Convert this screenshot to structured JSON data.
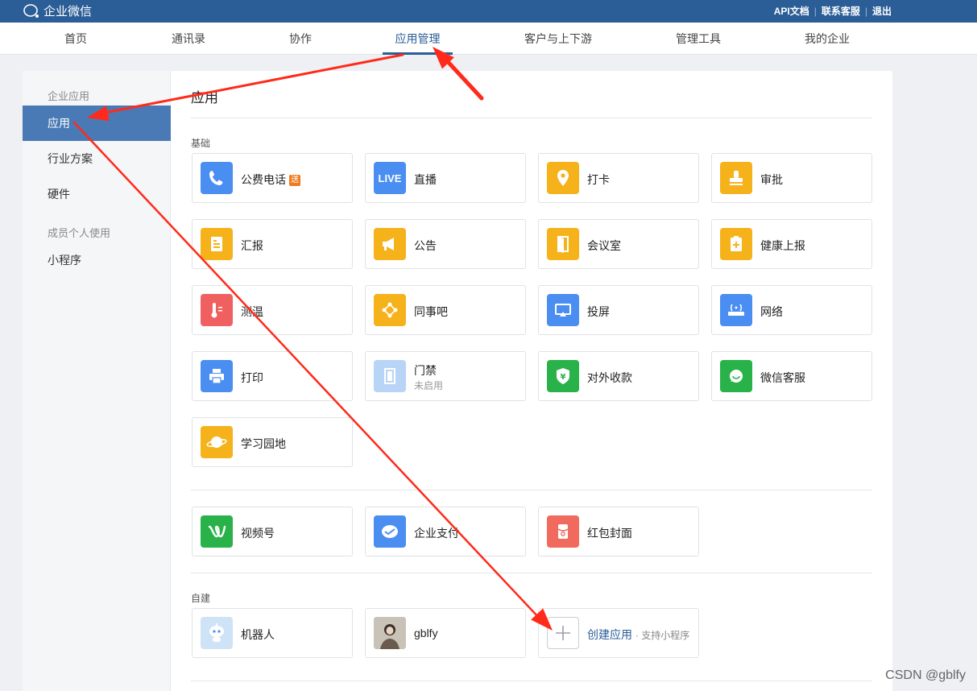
{
  "topbar": {
    "brand": "企业微信",
    "links": [
      "API文档",
      "联系客服",
      "退出"
    ]
  },
  "nav": {
    "tabs": [
      "首页",
      "通讯录",
      "协作",
      "应用管理",
      "客户与上下游",
      "管理工具",
      "我的企业"
    ],
    "active": "应用管理"
  },
  "sidebar": {
    "group1": "企业应用",
    "items": [
      "应用",
      "行业方案",
      "硬件"
    ],
    "group2": "成员个人使用",
    "items2": [
      "小程序"
    ],
    "active": "应用"
  },
  "main": {
    "title": "应用",
    "basic_label": "基础",
    "custom_label": "自建",
    "basic_apps": [
      {
        "name": "公费电话",
        "badge": "送",
        "icon": "phone-icon",
        "color": "#4a8ef2"
      },
      {
        "name": "直播",
        "icon": "live-icon",
        "icon_text": "LIVE",
        "color": "#4a8ef2"
      },
      {
        "name": "打卡",
        "icon": "location-pin-icon",
        "color": "#f5b21b"
      },
      {
        "name": "审批",
        "icon": "stamp-icon",
        "color": "#f5b21b"
      },
      {
        "name": "汇报",
        "icon": "report-icon",
        "color": "#f5b21b"
      },
      {
        "name": "公告",
        "icon": "megaphone-icon",
        "color": "#f5b21b"
      },
      {
        "name": "会议室",
        "icon": "door-icon",
        "color": "#f5b21b"
      },
      {
        "name": "健康上报",
        "icon": "health-clipboard-icon",
        "color": "#f5b21b"
      },
      {
        "name": "测温",
        "icon": "thermometer-icon",
        "color": "#f06060"
      },
      {
        "name": "同事吧",
        "icon": "network-icon",
        "color": "#f5b21b"
      },
      {
        "name": "投屏",
        "icon": "screen-cast-icon",
        "color": "#4a8ef2"
      },
      {
        "name": "网络",
        "icon": "router-icon",
        "color": "#4a8ef2"
      },
      {
        "name": "打印",
        "icon": "printer-icon",
        "color": "#4a8ef2"
      },
      {
        "name": "门禁",
        "sub": "未启用",
        "icon": "door-access-icon",
        "color": "#b8d4f7"
      },
      {
        "name": "对外收款",
        "icon": "yuan-shield-icon",
        "color": "#2ab24a"
      },
      {
        "name": "微信客服",
        "icon": "chat-bubble-icon",
        "color": "#2ab24a"
      },
      {
        "name": "学习园地",
        "icon": "planet-icon",
        "color": "#f5b21b"
      }
    ],
    "wechat_apps": [
      {
        "name": "视频号",
        "icon": "channels-icon",
        "color": "#2ab24a"
      },
      {
        "name": "企业支付",
        "icon": "pay-icon",
        "color": "#4a8ef2"
      },
      {
        "name": "红包封面",
        "icon": "red-packet-icon",
        "color": "#f06a5e"
      }
    ],
    "custom_apps": [
      {
        "name": "机器人",
        "icon": "robot-icon",
        "color": "#cfe3f7"
      },
      {
        "name": "gblfy",
        "icon": "user-photo-icon",
        "color": "#8a7a6a"
      }
    ],
    "create": {
      "label": "创建应用",
      "note": "· 支持小程序",
      "icon": "plus-icon"
    }
  },
  "watermark": "CSDN @gblfy",
  "annotation_color": "#ff2a1a"
}
